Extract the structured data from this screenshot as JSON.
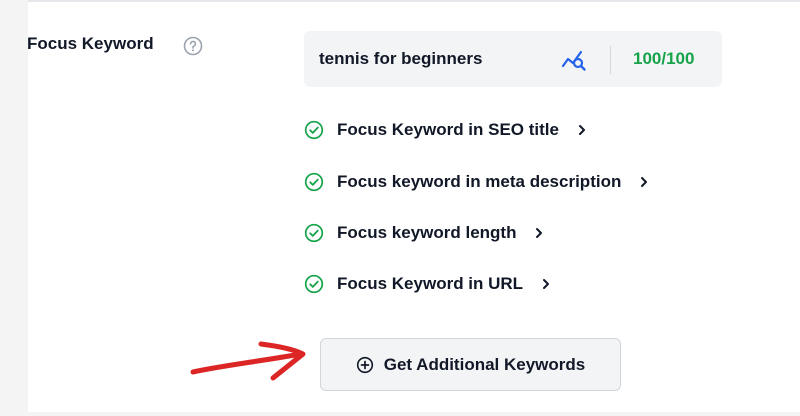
{
  "focus_keyword": {
    "label": "Focus Keyword",
    "help_icon": "question-circle-icon",
    "keyword_value": "tennis for beginners",
    "analyze_icon": "keyword-analysis-icon",
    "score": "100/100",
    "score_color": "#16a34a"
  },
  "checks": [
    {
      "label": "Focus Keyword in SEO title",
      "status_icon": "check-circle-icon",
      "status_color": "#16a34a"
    },
    {
      "label": "Focus keyword in meta description",
      "status_icon": "check-circle-icon",
      "status_color": "#16a34a"
    },
    {
      "label": "Focus keyword length",
      "status_icon": "check-circle-icon",
      "status_color": "#16a34a"
    },
    {
      "label": "Focus Keyword in URL",
      "status_icon": "check-circle-icon",
      "status_color": "#16a34a"
    }
  ],
  "additional_keywords_button": {
    "label": "Get Additional Keywords",
    "icon": "plus-circle-icon"
  },
  "annotation": {
    "icon": "hand-drawn-arrow-icon",
    "color": "#dc2626"
  }
}
